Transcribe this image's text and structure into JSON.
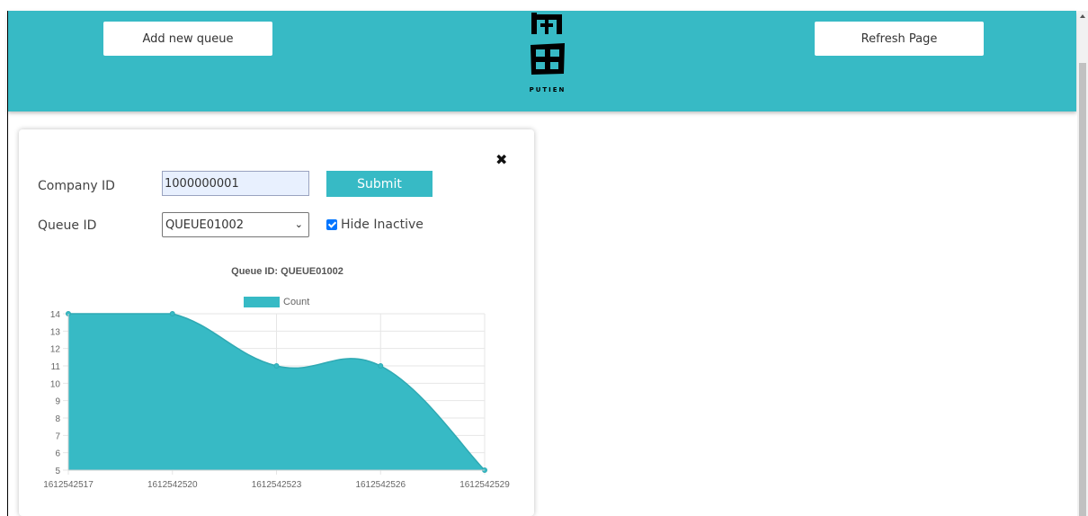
{
  "header": {
    "add_queue_label": "Add new queue",
    "refresh_label": "Refresh Page",
    "logo_text": "PUTIEN",
    "background_color": "#37bac5"
  },
  "form": {
    "company_id_label": "Company ID",
    "company_id_value": "1000000001",
    "submit_label": "Submit",
    "queue_id_label": "Queue ID",
    "queue_id_selected": "QUEUE01002",
    "hide_inactive_label": "Hide Inactive",
    "hide_inactive_checked": true,
    "close_icon": "close-icon"
  },
  "chart_data": {
    "type": "area",
    "title": "Queue ID: QUEUE01002",
    "xlabel": "",
    "ylabel": "",
    "x": [
      "1612542517",
      "1612542520",
      "1612542523",
      "1612542526",
      "1612542529"
    ],
    "series": [
      {
        "name": "Count",
        "values": [
          14,
          14,
          11,
          11,
          5
        ],
        "color": "#37bac5"
      }
    ],
    "ylim": [
      5,
      14
    ],
    "yticks": [
      5,
      6,
      7,
      8,
      9,
      10,
      11,
      12,
      13,
      14
    ],
    "grid": true,
    "legend": "top"
  }
}
